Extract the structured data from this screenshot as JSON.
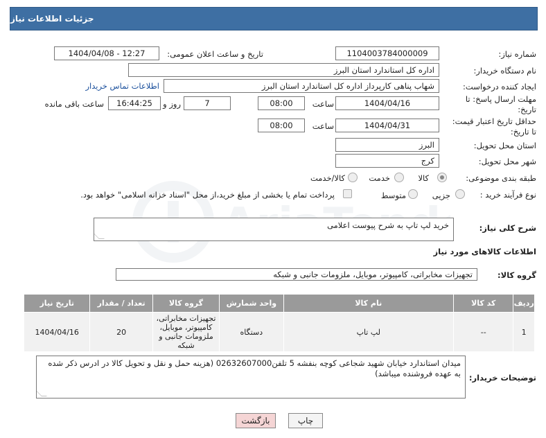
{
  "header": {
    "title": "جزئیات اطلاعات نیاز"
  },
  "fields": {
    "need_number_label": "شماره نیاز:",
    "need_number": "1104003784000009",
    "announce_label": "تاریخ و ساعت اعلان عمومی:",
    "announce_value": "1404/04/08 - 12:27",
    "buyer_org_label": "نام دستگاه خریدار:",
    "buyer_org": "اداره کل استاندارد استان البرز",
    "requester_label": "ایجاد کننده درخواست:",
    "requester": "شهاب پناهی کارپرداز اداره کل استاندارد استان البرز",
    "contact_link": "اطلاعات تماس خریدار",
    "deadline_label_1": "مهلت ارسال پاسخ: تا",
    "deadline_label_2": "تاریخ:",
    "deadline_date": "1404/04/16",
    "time_label": "ساعت",
    "deadline_time": "08:00",
    "days_value": "7",
    "days_label": "روز و",
    "remaining_time": "16:44:25",
    "remaining_label": "ساعت باقی مانده",
    "validity_label_1": "حداقل تاریخ اعتبار قیمت:",
    "validity_label_2": "تا تاریخ:",
    "validity_date": "1404/04/31",
    "validity_time": "08:00",
    "province_label": "استان محل تحویل:",
    "province": "البرز",
    "city_label": "شهر محل تحویل:",
    "city": "کرج",
    "category_label": "طبقه بندی موضوعی:",
    "category_options": [
      "کالا",
      "خدمت",
      "کالا/خدمت"
    ],
    "process_label": "نوع فرآیند خرید :",
    "process_options": [
      "جزیی",
      "متوسط"
    ],
    "payment_note": "پرداخت تمام یا بخشی از مبلغ خرید،از محل \"اسناد خزانه اسلامی\" خواهد بود."
  },
  "description": {
    "label": "شرح کلی نیاز:",
    "text": "خرید لپ تاپ به شرح پیوست اعلامی"
  },
  "goods": {
    "section_title": "اطلاعات کالاهای مورد نیاز",
    "group_label": "گروه کالا:",
    "group_value": "تجهیزات مخابراتی، کامپیوتر، موبایل، ملزومات جانبی و شبکه",
    "columns": [
      "ردیف",
      "کد کالا",
      "نام کالا",
      "واحد شمارش",
      "گروه کالا",
      "تعداد / مقدار",
      "تاریخ نیاز"
    ],
    "rows": [
      [
        "1",
        "--",
        "لپ تاپ",
        "دستگاه",
        "تجهیزات مخابراتی، کامپیوتر، موبایل، ملزومات جانبی و شبکه",
        "20",
        "1404/04/16"
      ]
    ]
  },
  "buyer_notes": {
    "label": "توضیحات خریدار:",
    "text": "میدان استاندارد خیابان شهید شجاعی کوچه بنفشه 5 تلفن02632607000 (هزینه حمل و نقل و تحویل کالا در ادرس ذکر شده به عهده فروشنده میباشد)"
  },
  "buttons": {
    "print": "چاپ",
    "back": "بازگشت"
  },
  "colors": {
    "header_bg": "#3e6fa3",
    "table_header_bg": "#9a9a9a",
    "back_btn_bg": "#f5d5d5"
  }
}
